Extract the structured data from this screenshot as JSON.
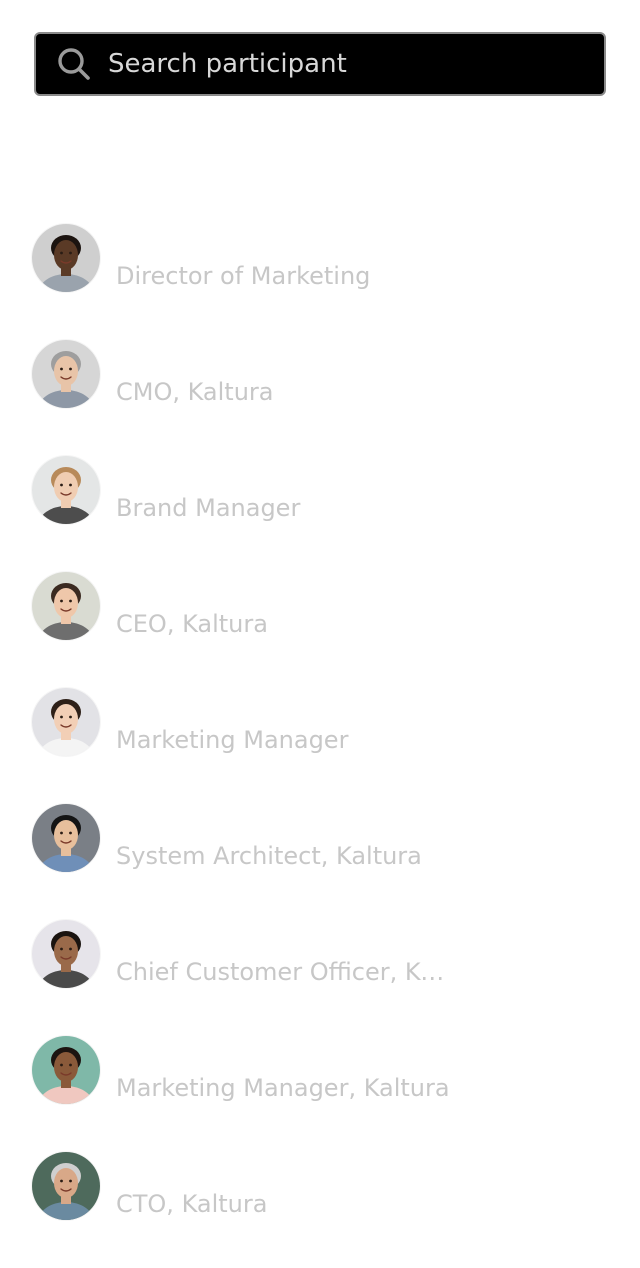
{
  "search": {
    "placeholder": "Search participant",
    "value": ""
  },
  "participants": [
    {
      "title": "Director of Marketing",
      "avatar": {
        "bg": "#cfcfcf",
        "skin": "#5a3a26",
        "hair": "#1c1410",
        "shirt": "#9aa3ad"
      }
    },
    {
      "title": "CMO, Kaltura",
      "avatar": {
        "bg": "#d6d6d6",
        "skin": "#e8c4a8",
        "hair": "#9e9e9e",
        "shirt": "#8e98a6"
      }
    },
    {
      "title": "Brand Manager",
      "avatar": {
        "bg": "#e4e6e6",
        "skin": "#f0cdb2",
        "hair": "#b88a5a",
        "shirt": "#4d4d4d"
      }
    },
    {
      "title": "CEO, Kaltura",
      "avatar": {
        "bg": "#d9dbd2",
        "skin": "#efc7aa",
        "hair": "#3b2a20",
        "shirt": "#6e6e6e"
      }
    },
    {
      "title": "Marketing Manager",
      "avatar": {
        "bg": "#e2e2e6",
        "skin": "#f2cfb6",
        "hair": "#2e2018",
        "shirt": "#f4f4f4"
      }
    },
    {
      "title": "System Architect, Kaltura",
      "avatar": {
        "bg": "#7a7f86",
        "skin": "#e7bf9c",
        "hair": "#141414",
        "shirt": "#6f8fb8"
      }
    },
    {
      "title": "Chief Customer Officer, Kaltura",
      "avatar": {
        "bg": "#e6e4ea",
        "skin": "#9a6a4a",
        "hair": "#1a1410",
        "shirt": "#4a4a4a"
      }
    },
    {
      "title": "Marketing Manager, Kaltura",
      "avatar": {
        "bg": "#7fb8a8",
        "skin": "#8a5a3a",
        "hair": "#1c1410",
        "shirt": "#f0c8c0"
      }
    },
    {
      "title": "CTO, Kaltura",
      "avatar": {
        "bg": "#4e6a5c",
        "skin": "#d8a888",
        "hair": "#cfcfcf",
        "shirt": "#6a8aa0"
      }
    }
  ]
}
